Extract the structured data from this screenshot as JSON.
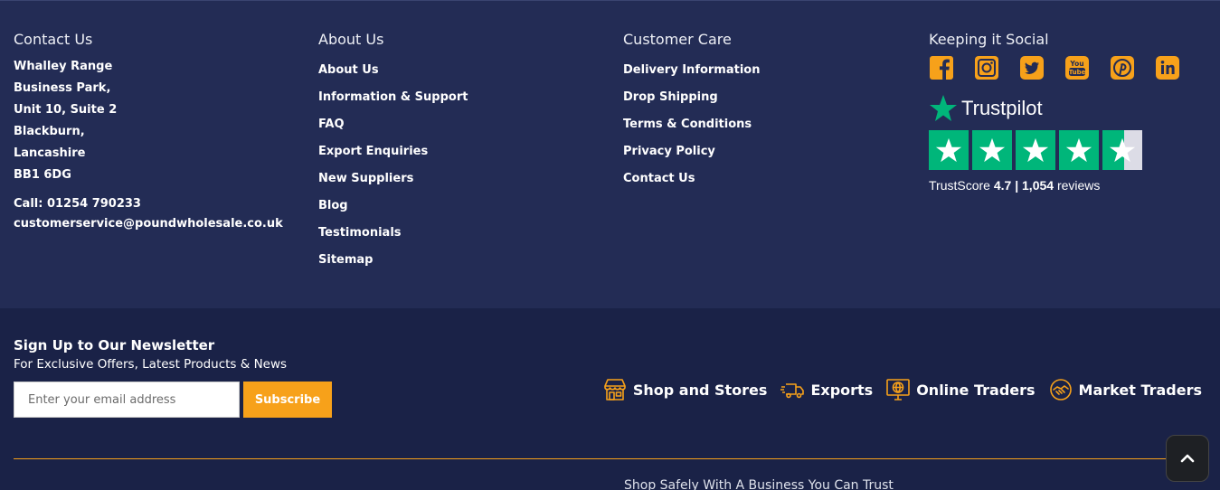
{
  "contact": {
    "heading": "Contact Us",
    "address": [
      "Whalley Range",
      "Business Park,",
      "Unit 10, Suite 2",
      "Blackburn,",
      "Lancashire",
      "BB1 6DG"
    ],
    "phone": "Call: 01254 790233",
    "email": "customerservice@poundwholesale.co.uk"
  },
  "about": {
    "heading": "About Us",
    "links": [
      "About Us",
      "Information & Support",
      "FAQ",
      "Export Enquiries",
      "New Suppliers",
      "Blog",
      "Testimonials",
      "Sitemap"
    ]
  },
  "care": {
    "heading": "Customer Care",
    "links": [
      "Delivery Information",
      "Drop Shipping",
      "Terms & Conditions",
      "Privacy Policy",
      "Contact Us"
    ]
  },
  "social": {
    "heading": "Keeping it Social",
    "icons": [
      "facebook-icon",
      "instagram-icon",
      "twitter-icon",
      "youtube-icon",
      "pinterest-icon",
      "linkedin-icon"
    ],
    "icon_color": "#f7a11a"
  },
  "trustpilot": {
    "brand": "Trustpilot",
    "score_label": "TrustScore",
    "score": "4.7",
    "separator": "|",
    "reviews_count": "1,054",
    "reviews_label": "reviews",
    "stars": 4.5,
    "star_color": "#00b67a"
  },
  "newsletter": {
    "title": "Sign Up to Our Newsletter",
    "subtitle": "For Exclusive Offers, Latest Products & News",
    "placeholder": "Enter your email address",
    "button": "Subscribe"
  },
  "trade_types": [
    {
      "label": "Shop and Stores",
      "icon": "store-icon"
    },
    {
      "label": "Exports",
      "icon": "truck-icon"
    },
    {
      "label": "Online Traders",
      "icon": "globe-monitor-icon"
    },
    {
      "label": "Market Traders",
      "icon": "handshake-icon"
    }
  ],
  "trust_text": "Shop Safely With A Business You Can Trust",
  "colors": {
    "top_bg": "#232c55",
    "bottom_bg": "#1a2247",
    "accent": "#f7a11a"
  }
}
